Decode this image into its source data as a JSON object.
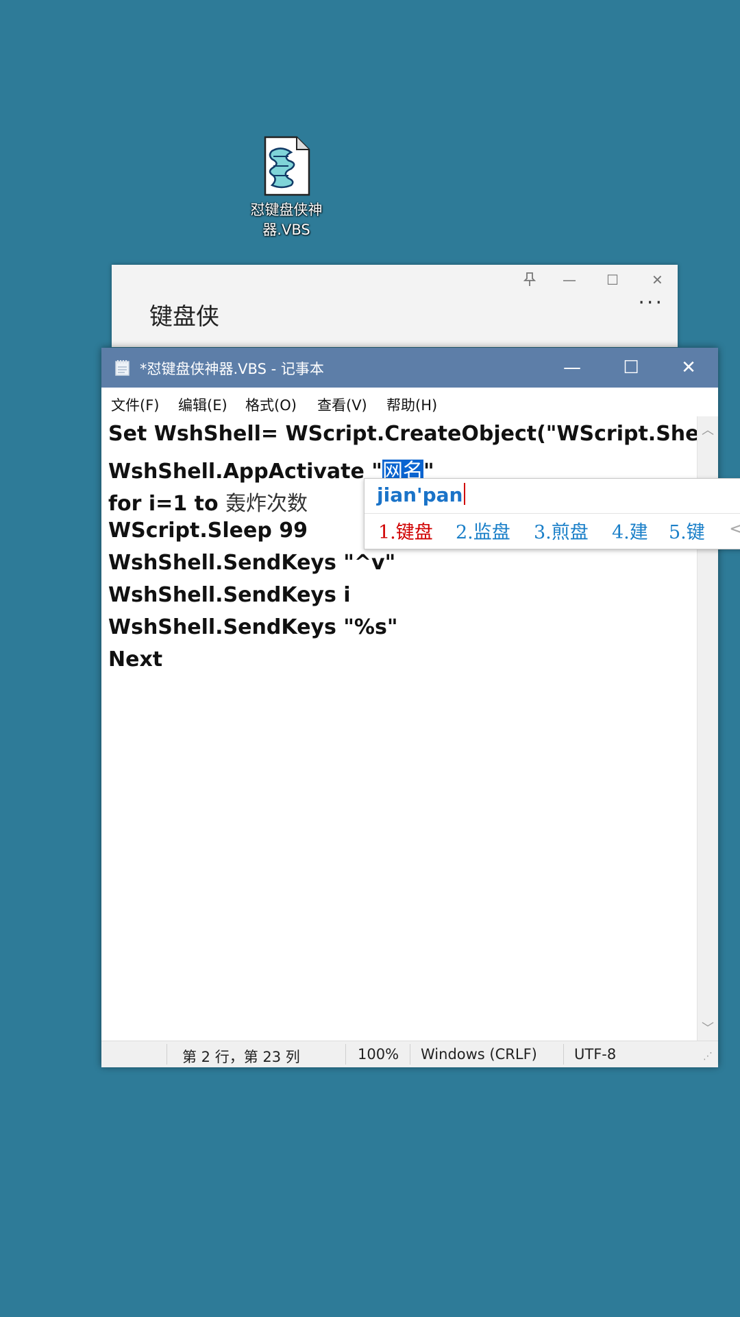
{
  "desktop": {
    "file_icon": "vbs-script-file-icon",
    "file_label_line1": "怼键盘侠神",
    "file_label_line2": "器.VBS"
  },
  "background_window": {
    "title": "键盘侠",
    "more": "···",
    "pin_icon": "pin-icon",
    "minimize_glyph": "—",
    "maximize_glyph": "☐",
    "close_glyph": "✕"
  },
  "notepad": {
    "title": "*怼键盘侠神器.VBS - 记事本",
    "app_icon": "notepad-icon",
    "controls": {
      "minimize": "—",
      "maximize": "☐",
      "close": "✕"
    },
    "menu": [
      "文件(F)",
      "编辑(E)",
      "格式(O)",
      "查看(V)",
      "帮助(H)"
    ],
    "lines": {
      "l1": "Set WshShell= WScript.CreateObject(\"WScript.Shell\")",
      "l2_prefix": "WshShell.AppActivate \"",
      "l2_selected": "网名",
      "l2_suffix": "\"",
      "l3_prefix": "for i=1 to ",
      "l3_cjk": "轰炸次数",
      "l4": "WScript.Sleep 99",
      "l5": "WshShell.SendKeys \"^v\"",
      "l6": "WshShell.SendKeys i",
      "l7": "WshShell.SendKeys \"%s\"",
      "l8": "Next"
    },
    "status": {
      "position": "第 2 行，第 23 列",
      "zoom": "100%",
      "line_ending": "Windows (CRLF)",
      "encoding": "UTF-8"
    }
  },
  "ime": {
    "input": "jian'pan",
    "candidates": [
      "1.键盘",
      "2.监盘",
      "3.煎盘",
      "4.建",
      "5.键"
    ],
    "prev_glyph": "<"
  }
}
